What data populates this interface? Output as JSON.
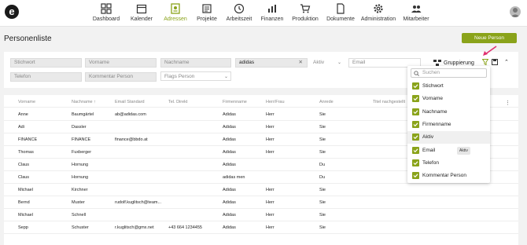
{
  "app": {
    "logo": "e"
  },
  "nav": [
    {
      "label": "Dashboard",
      "icon": "dashboard-icon",
      "active": false
    },
    {
      "label": "Kalender",
      "icon": "calendar-icon",
      "active": false
    },
    {
      "label": "Adressen",
      "icon": "contacts-icon",
      "active": true
    },
    {
      "label": "Projekte",
      "icon": "projects-icon",
      "active": false
    },
    {
      "label": "Arbeitszeit",
      "icon": "clock-icon",
      "active": false
    },
    {
      "label": "Finanzen",
      "icon": "finance-icon",
      "active": false
    },
    {
      "label": "Produktion",
      "icon": "cart-icon",
      "active": false
    },
    {
      "label": "Dokumente",
      "icon": "document-icon",
      "active": false
    },
    {
      "label": "Administration",
      "icon": "gear-icon",
      "active": false
    },
    {
      "label": "Mitarbeiter",
      "icon": "team-icon",
      "active": false
    }
  ],
  "page": {
    "title": "Personenliste",
    "new_button": "Neue Person"
  },
  "filters": {
    "stichwort": "Stichwort",
    "vorname": "Vorname",
    "nachname": "Nachname",
    "firmenname_value": "adidas",
    "aktiv": "Aktiv",
    "email": "Email",
    "telefon": "Telefon",
    "kommentar": "Kommentar Person",
    "flags": "Flags Person",
    "gruppierung": "Gruppierung"
  },
  "table": {
    "headers": [
      "Vorname",
      "Nachname ↑",
      "Email Standard",
      "Tel. Direkt",
      "Firmenname",
      "Herr/Frau",
      "Anrede",
      "Titel nachgestellt"
    ],
    "rows": [
      [
        "Anne",
        "Baumgärtel",
        "ab@adidas.com",
        "",
        "Adidas",
        "Herr",
        "Sie"
      ],
      [
        "Adi",
        "Dassler",
        "",
        "",
        "Adidas",
        "Herr",
        "Sie"
      ],
      [
        "FINANCE",
        "FINANCE",
        "finance@bbdo.at",
        "",
        "Adidas",
        "Herr",
        "Sie"
      ],
      [
        "Thomas",
        "Fuxberger",
        "",
        "",
        "Adidas",
        "Herr",
        "Sie"
      ],
      [
        "Claus",
        "Hornung",
        "",
        "",
        "Adidas",
        "",
        "Du"
      ],
      [
        "Claus",
        "Hornung",
        "",
        "",
        "adidas men",
        "",
        "Du"
      ],
      [
        "Michael",
        "Kirchner",
        "",
        "",
        "Adidas",
        "Herr",
        "Sie"
      ],
      [
        "Bernd",
        "Muster",
        "rudolf.kuglitsch@team...",
        "",
        "Adidas",
        "Herr",
        "Sie"
      ],
      [
        "Michael",
        "Schnell",
        "",
        "",
        "Adidas",
        "Herr",
        "Sie"
      ],
      [
        "Sepp",
        "Schuster",
        "r.kuglitsch@gmx.net",
        "+43 664 1234455",
        "Adidas",
        "Herr",
        "Sie"
      ]
    ]
  },
  "dropdown": {
    "search_placeholder": "Suchen",
    "items": [
      "Stichwort",
      "Vorname",
      "Nachname",
      "Firmenname",
      "Aktiv",
      "Email",
      "Telefon",
      "Kommentar Person"
    ],
    "tooltip": "Aktiv"
  },
  "colors": {
    "accent": "#8aa31a",
    "arrow": "#e0306f"
  }
}
